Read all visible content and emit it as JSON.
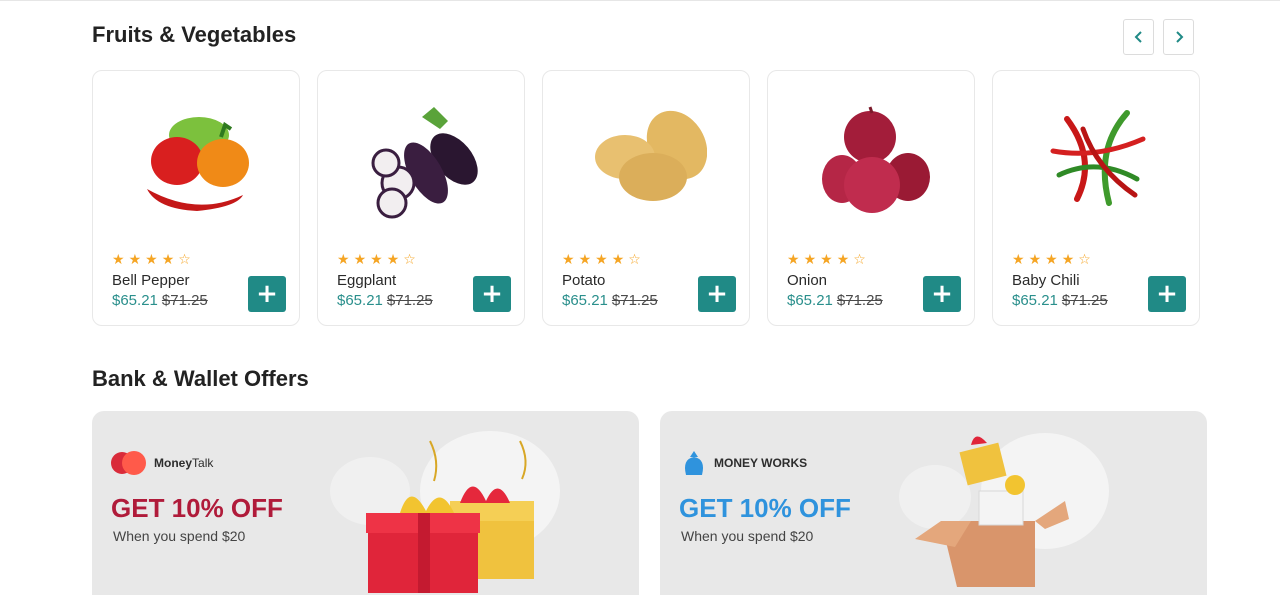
{
  "sections": {
    "fruits_title": "Fruits & Vegetables",
    "offers_title": "Bank & Wallet Offers"
  },
  "nav": {
    "prev_icon": "chevron-left-icon",
    "next_icon": "chevron-right-icon"
  },
  "products": [
    {
      "name": "Bell Pepper",
      "price": "$65.21",
      "old_price": "$71.25",
      "rating": 4,
      "image": "bell-pepper-image"
    },
    {
      "name": "Eggplant",
      "price": "$65.21",
      "old_price": "$71.25",
      "rating": 4,
      "image": "eggplant-image"
    },
    {
      "name": "Potato",
      "price": "$65.21",
      "old_price": "$71.25",
      "rating": 4,
      "image": "potato-image"
    },
    {
      "name": "Onion",
      "price": "$65.21",
      "old_price": "$71.25",
      "rating": 4,
      "image": "onion-image"
    },
    {
      "name": "Baby Chili",
      "price": "$65.21",
      "old_price": "$71.25",
      "rating": 4,
      "image": "chili-image"
    }
  ],
  "add_label": "+",
  "offers": [
    {
      "brand_a": "Money",
      "brand_b": "Talk",
      "headline": "GET 10% OFF",
      "sub": "When you spend $20",
      "headline_color": "#b01b3a"
    },
    {
      "brand_a": "MONEY WORKS",
      "brand_b": "",
      "headline": "GET 10% OFF",
      "sub": "When you spend $20",
      "headline_color": "#2f93dd"
    }
  ],
  "colors": {
    "accent": "#208a86",
    "price": "#2a8f8c",
    "star": "#f5a524"
  }
}
